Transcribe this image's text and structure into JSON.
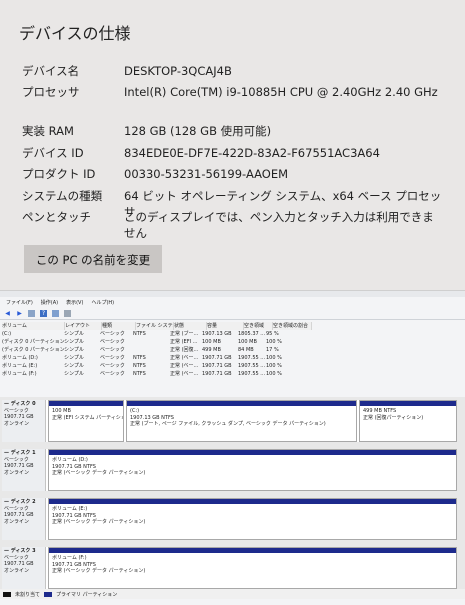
{
  "device_specs": {
    "title": "デバイスの仕様",
    "rows": [
      {
        "label": "デバイス名",
        "value": "DESKTOP-3QCAJ4B"
      },
      {
        "label": "プロセッサ",
        "value": "Intel(R) Core(TM) i9-10885H CPU @ 2.40GHz   2.40 GHz"
      },
      {
        "label": "実装 RAM",
        "value": "128 GB (128 GB 使用可能)"
      },
      {
        "label": "デバイス ID",
        "value": "834EDE0E-DF7E-422D-83A2-F67551AC3A64"
      },
      {
        "label": "プロダクト ID",
        "value": "00330-53231-56199-AAOEM"
      },
      {
        "label": "システムの種類",
        "value": "64 ビット オペレーティング システム、x64 ベース プロセッサ"
      },
      {
        "label": "ペンとタッチ",
        "value": "このディスプレイでは、ペン入力とタッチ入力は利用できません"
      }
    ],
    "rename_button": "この PC の名前を変更"
  },
  "disk_mgmt": {
    "menu": [
      "ファイル(F)",
      "操作(A)",
      "表示(V)",
      "ヘルプ(H)"
    ],
    "toolbar_icons": [
      "back-arrow-icon",
      "forward-arrow-icon",
      "properties-icon",
      "help-icon",
      "refresh-icon",
      "settings-icon"
    ],
    "table_headers": [
      "ボリューム",
      "レイアウト",
      "種類",
      "ファイル システム",
      "状態",
      "容量",
      "空き領域",
      "空き領域の割合"
    ],
    "table_rows": [
      [
        "(C:)",
        "シンプル",
        "ベーシック",
        "NTFS",
        "正常 (ブー...",
        "1907.13 GB",
        "1805.37 ...",
        "95 %"
      ],
      [
        "(ディスク 0 パーティション 1)",
        "シンプル",
        "ベーシック",
        "",
        "正常 (EFI ...",
        "100 MB",
        "100 MB",
        "100 %"
      ],
      [
        "(ディスク 0 パーティション 4)",
        "シンプル",
        "ベーシック",
        "",
        "正常 (回復...",
        "499 MB",
        "84 MB",
        "17 %"
      ],
      [
        "ボリューム (D:)",
        "シンプル",
        "ベーシック",
        "NTFS",
        "正常 (ベー...",
        "1907.71 GB",
        "1907.55 ...",
        "100 %"
      ],
      [
        "ボリューム (E:)",
        "シンプル",
        "ベーシック",
        "NTFS",
        "正常 (ベー...",
        "1907.71 GB",
        "1907.55 ...",
        "100 %"
      ],
      [
        "ボリューム (F:)",
        "シンプル",
        "ベーシック",
        "NTFS",
        "正常 (ベー...",
        "1907.71 GB",
        "1907.55 ...",
        "100 %"
      ]
    ],
    "disks": [
      {
        "name": "ディスク 0",
        "type": "ベーシック",
        "size": "1907.71 GB",
        "status": "オンライン",
        "partitions": [
          {
            "title": "",
            "size": "100 MB",
            "status": "正常 (EFI システム パーティション)"
          },
          {
            "title": "(C:)",
            "size": "1907.13 GB NTFS",
            "status": "正常 (ブート, ページ ファイル, クラッシュ ダンプ, ベーシック データ パーティション)"
          },
          {
            "title": "",
            "size": "499 MB NTFS",
            "status": "正常 (回復パーティション)"
          }
        ]
      },
      {
        "name": "ディスク 1",
        "type": "ベーシック",
        "size": "1907.71 GB",
        "status": "オンライン",
        "partitions": [
          {
            "title": "ボリューム (D:)",
            "size": "1907.71 GB NTFS",
            "status": "正常 (ベーシック データ パーティション)"
          }
        ]
      },
      {
        "name": "ディスク 2",
        "type": "ベーシック",
        "size": "1907.71 GB",
        "status": "オンライン",
        "partitions": [
          {
            "title": "ボリューム (E:)",
            "size": "1907.71 GB NTFS",
            "status": "正常 (ベーシック データ パーティション)"
          }
        ]
      },
      {
        "name": "ディスク 3",
        "type": "ベーシック",
        "size": "1907.71 GB",
        "status": "オンライン",
        "partitions": [
          {
            "title": "ボリューム (F:)",
            "size": "1907.71 GB NTFS",
            "status": "正常 (ベーシック データ パーティション)"
          }
        ]
      }
    ],
    "legend": [
      {
        "label": "未割り当て",
        "color": "#111111"
      },
      {
        "label": "プライマリ パーティション",
        "color": "#1d2a8c"
      }
    ]
  }
}
